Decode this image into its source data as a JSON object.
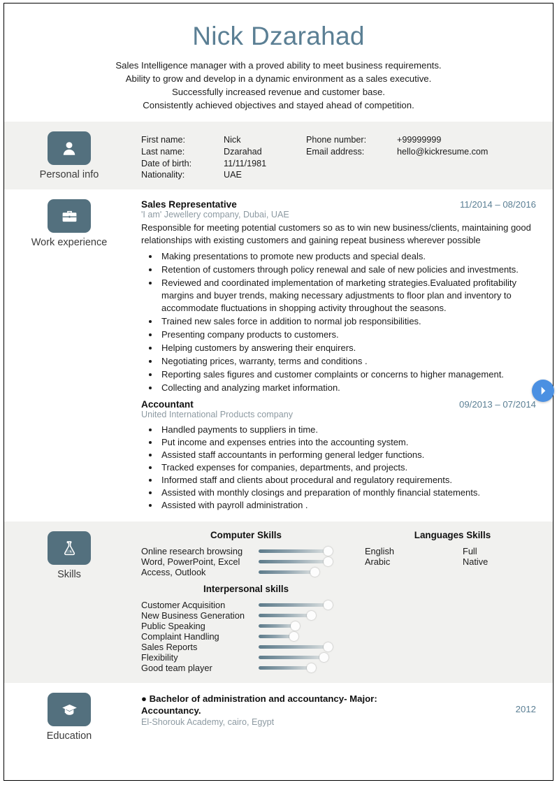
{
  "document_type": "resume",
  "colors": {
    "accent_blue_gray": "#5b7f94",
    "icon_badge": "#53707e",
    "muted_company": "#8d9aa2",
    "shaded_band": "#f1f1ef",
    "next_button_blue": "#4b90e2"
  },
  "header": {
    "name": "Nick Dzarahad",
    "summary_lines": [
      "Sales Intelligence manager with a proved ability to meet business requirements.",
      "Ability to grow and develop in a dynamic environment as a sales executive.",
      "Successfully increased revenue and customer base.",
      "Consistently achieved objectives and stayed ahead of competition."
    ]
  },
  "sections": {
    "personal_info": {
      "label": "Personal info",
      "icon": "person-icon",
      "left_fields": [
        {
          "key": "First name:",
          "value": "Nick"
        },
        {
          "key": "Last name:",
          "value": "Dzarahad"
        },
        {
          "key": "Date of birth:",
          "value": "11/11/1981"
        },
        {
          "key": "Nationality:",
          "value": "UAE"
        }
      ],
      "right_fields": [
        {
          "key": "Phone number:",
          "value": "+99999999"
        },
        {
          "key": "Email address:",
          "value": "hello@kickresume.com"
        }
      ]
    },
    "work_experience": {
      "label": "Work experience",
      "icon": "briefcase-icon",
      "jobs": [
        {
          "title": "Sales Representative",
          "dates": "11/2014 – 08/2016",
          "company": "'I am' Jewellery company, Dubai, UAE",
          "description": "Responsible for meeting potential customers so as to win new business/clients, maintaining good relationships with existing customers and gaining repeat business wherever possible",
          "bullets": [
            "Making presentations to promote new products and special deals.",
            "Retention of customers through policy renewal and sale of new policies and investments.",
            "Reviewed and coordinated implementation of marketing strategies.Evaluated profitability margins and buyer trends, making necessary adjustments to floor plan and inventory to accommodate fluctuations in shopping activity throughout the seasons.",
            "Trained new sales force in addition to normal job responsibilities.",
            "Presenting company products to customers.",
            "Helping customers by answering their enquirers.",
            "Negotiating prices, warranty, terms and conditions .",
            "Reporting sales figures and customer complaints or concerns to higher management.",
            "Collecting and analyzing market information."
          ]
        },
        {
          "title": "Accountant",
          "dates": "09/2013 – 07/2014",
          "company": "United International Products company",
          "description": "",
          "bullets": [
            "Handled payments to suppliers in time.",
            "Put income and expenses entries into the accounting system.",
            "Assisted staff accountants in performing general ledger functions.",
            "Tracked expenses for companies, departments, and projects.",
            "Informed staff and clients about procedural and regulatory requirements.",
            "Assisted with monthly closings and preparation of monthly financial statements.",
            "Assisted with payroll administration ."
          ]
        }
      ]
    },
    "skills": {
      "label": "Skills",
      "icon": "flask-icon",
      "computer_skills": {
        "heading": "Computer Skills",
        "items": [
          {
            "name": "Online research browsing",
            "level": 95
          },
          {
            "name": "Word, PowerPoint, Excel",
            "level": 95
          },
          {
            "name": "Access, Outlook",
            "level": 78
          }
        ]
      },
      "languages": {
        "heading": "Languages Skills",
        "items": [
          {
            "name": "English",
            "level_label": "Full"
          },
          {
            "name": "Arabic",
            "level_label": "Native"
          }
        ]
      },
      "interpersonal_skills": {
        "heading": "Interpersonal skills",
        "items": [
          {
            "name": "Customer Acquisition",
            "level": 95
          },
          {
            "name": "New Business Generation",
            "level": 73
          },
          {
            "name": "Public Speaking",
            "level": 53
          },
          {
            "name": "Complaint Handling",
            "level": 51
          },
          {
            "name": "Sales Reports",
            "level": 95
          },
          {
            "name": "Flexibility",
            "level": 89
          },
          {
            "name": "Good team player",
            "level": 73
          }
        ]
      }
    },
    "education": {
      "label": "Education",
      "icon": "graduation-cap-icon",
      "entries": [
        {
          "degree": "● Bachelor of administration and accountancy- Major: Accountancy.",
          "school": "El-Shorouk Academy, cairo, Egypt",
          "year": "2012"
        }
      ]
    }
  },
  "controls": {
    "next_button": "next-arrow"
  }
}
